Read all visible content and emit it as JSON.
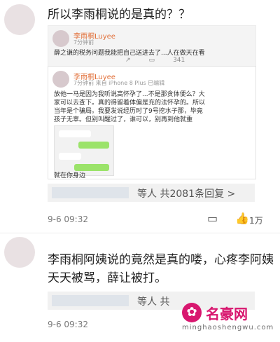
{
  "comments": [
    {
      "text": "所以李雨桐说的是真的？？",
      "repost": {
        "author": "李雨桐Luyee",
        "meta": "7分钟前",
        "body": "薛之谦的税务问题我能把自己送进去了...人在做天在看",
        "actions": [
          "",
          "",
          "341"
        ]
      },
      "post": {
        "author": "李雨桐Luyee",
        "meta": "7分钟前 来自 iPhone 8 Plus 已编辑",
        "body_lines": [
          "放他一马是因为我听说高怀孕了...不是那贪体便么？大",
          "家可以去查下。真的得留着体偏是充的法怀孕的。所以",
          "当年是个骗局。我要发说经历时了9号挖水子那，毕竟",
          "孩子无辜。但别叫醒过了，谁可以，别再到他就重"
        ],
        "chat_note": "就在你身边"
      },
      "replies": "等人  共2081条回复 >",
      "time": "9-6 09:32",
      "likes": "1万"
    },
    {
      "text_lines": [
        "李雨桐阿姨说的竟然是真的喽，心疼李阿姨",
        "天天被骂，薛让被打。"
      ],
      "replies": "等人  共",
      "time": "9-6 09:32",
      "likes": ""
    }
  ],
  "watermark": {
    "title": "名豪网",
    "url": "minghaoshengwu.com"
  },
  "icons": {
    "reply": "comment-icon",
    "like": "thumb-up-icon"
  }
}
